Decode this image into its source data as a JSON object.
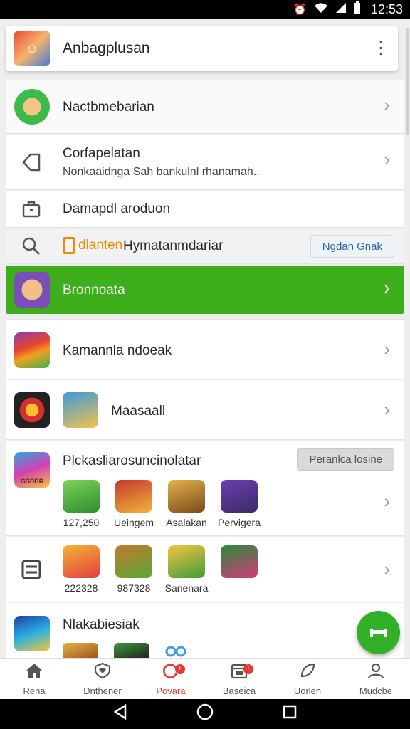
{
  "status_bar": {
    "time": "12:53"
  },
  "header": {
    "title": "Anbagplusan",
    "menu_icon": "more-vert-icon"
  },
  "rows": {
    "r1": {
      "label": "Nactbmebarian"
    },
    "r2": {
      "label": "Corfapelatan",
      "sublabel": "Nonkaaidnga Sah bankulnl rhanamah.."
    },
    "r3": {
      "label": "Damapdl aroduon"
    },
    "r4": {
      "tag": "dlanten",
      "label": "Hymatanmdariar",
      "button": "Ngdan Gnak"
    },
    "r5": {
      "label": "Bronnoata"
    },
    "r6": {
      "label": "Kamannla ndoeak"
    },
    "r7": {
      "label": "Maasaall"
    },
    "r8": {
      "label": "Plckasliarosuncinolatar",
      "button": "Peranlca losine",
      "icon_text": "GSBBR",
      "tiles": [
        {
          "caption": "127,250"
        },
        {
          "caption": "Ueingem"
        },
        {
          "caption": "Asalakan"
        },
        {
          "caption": "Pervigera"
        }
      ]
    },
    "r9": {
      "tiles": [
        {
          "caption": "222328"
        },
        {
          "caption": "987328"
        },
        {
          "caption": "Sanenara"
        },
        {
          "caption": ""
        }
      ]
    },
    "r10": {
      "label": "Nlakabiesiak"
    }
  },
  "bottom_nav": [
    {
      "label": "Rena"
    },
    {
      "label": "Dnthener"
    },
    {
      "label": "Povara",
      "badge": "!"
    },
    {
      "label": "Baseica",
      "badge": "!"
    },
    {
      "label": "Uorlen"
    },
    {
      "label": "Mudcbe"
    }
  ],
  "colors": {
    "accent_green": "#3fae1c",
    "active_red": "#e53935",
    "fab_green": "#33b02a"
  }
}
